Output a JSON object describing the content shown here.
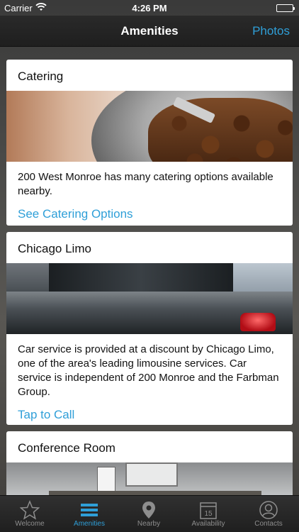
{
  "status_bar": {
    "carrier": "Carrier",
    "time": "4:26 PM"
  },
  "nav": {
    "title": "Amenities",
    "right_button": "Photos"
  },
  "cards": [
    {
      "title": "Catering",
      "image": "coffee-beans-image",
      "body": "200 West Monroe has many catering options available nearby.",
      "link": "See Catering Options"
    },
    {
      "title": "Chicago Limo",
      "image": "limousine-image",
      "body": "Car service is provided at a discount by Chicago Limo, one of the area's leading limousine services. Car service is independent of 200 Monroe and the Farbman Group.",
      "link": "Tap to Call"
    },
    {
      "title": "Conference Room",
      "image": "conference-room-image"
    }
  ],
  "tabs": [
    {
      "label": "Welcome",
      "icon": "star-icon",
      "active": false
    },
    {
      "label": "Amenities",
      "icon": "list-icon",
      "active": true
    },
    {
      "label": "Nearby",
      "icon": "map-pin-icon",
      "active": false
    },
    {
      "label": "Availability",
      "icon": "calendar-icon",
      "active": false,
      "badge": "15"
    },
    {
      "label": "Contacts",
      "icon": "person-icon",
      "active": false
    }
  ],
  "colors": {
    "accent": "#2f9fd8",
    "tab_inactive": "#8e8e8e"
  }
}
